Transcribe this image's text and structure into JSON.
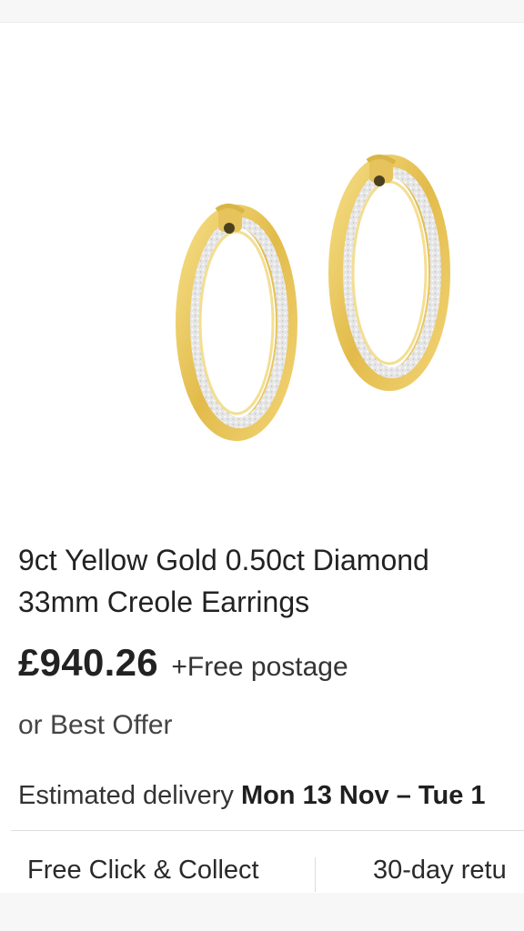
{
  "product": {
    "title_line1": "9ct Yellow Gold 0.50ct Diamond",
    "title_line2": "33mm Creole Earrings",
    "price": "£940.26",
    "postage": "+Free postage",
    "best_offer": "or Best Offer"
  },
  "delivery": {
    "label": "Estimated delivery",
    "dates": "Mon 13 Nov – Tue 1"
  },
  "features": {
    "collect": "Free Click & Collect",
    "returns": "30-day retu"
  },
  "image": {
    "subject": "earrings-icon",
    "gold_color": "#e8c55a",
    "diamond_color": "#e3e3e3"
  }
}
